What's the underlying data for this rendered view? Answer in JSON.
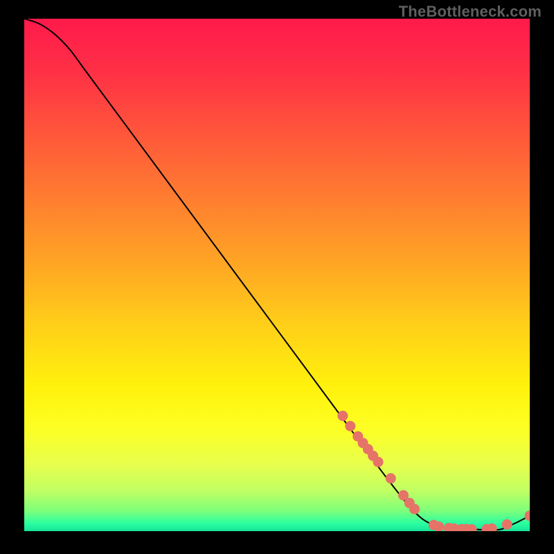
{
  "attribution": "TheBottleneck.com",
  "chart_data": {
    "type": "line",
    "title": "",
    "xlabel": "",
    "ylabel": "",
    "xlim": [
      0,
      100
    ],
    "ylim": [
      0,
      100
    ],
    "series": [
      {
        "name": "curve",
        "x": [
          0,
          3,
          6,
          9,
          12,
          18,
          30,
          45,
          60,
          72,
          78,
          82,
          86,
          90,
          94,
          97,
          100
        ],
        "y": [
          100,
          99,
          97,
          94,
          90,
          82,
          66,
          46,
          26,
          10,
          3,
          1,
          0.5,
          0.3,
          0.3,
          1.5,
          3
        ]
      }
    ],
    "markers": [
      {
        "name": "dots",
        "points": [
          {
            "x": 63,
            "y": 22.5
          },
          {
            "x": 64.5,
            "y": 20.5
          },
          {
            "x": 66,
            "y": 18.5
          },
          {
            "x": 67,
            "y": 17.2
          },
          {
            "x": 68,
            "y": 16
          },
          {
            "x": 69,
            "y": 14.7
          },
          {
            "x": 70,
            "y": 13.5
          },
          {
            "x": 72.5,
            "y": 10.3
          },
          {
            "x": 75,
            "y": 7
          },
          {
            "x": 76.2,
            "y": 5.5
          },
          {
            "x": 77.2,
            "y": 4.3
          },
          {
            "x": 81,
            "y": 1.2
          },
          {
            "x": 82,
            "y": 0.9
          },
          {
            "x": 84,
            "y": 0.6
          },
          {
            "x": 85,
            "y": 0.5
          },
          {
            "x": 86.5,
            "y": 0.4
          },
          {
            "x": 87.5,
            "y": 0.4
          },
          {
            "x": 88.5,
            "y": 0.35
          },
          {
            "x": 91.5,
            "y": 0.4
          },
          {
            "x": 92.5,
            "y": 0.5
          },
          {
            "x": 95.5,
            "y": 1.3
          },
          {
            "x": 100,
            "y": 3
          }
        ]
      }
    ],
    "gradient_stops": [
      {
        "offset": 0.0,
        "color": "#ff1a4b"
      },
      {
        "offset": 0.1,
        "color": "#ff2f46"
      },
      {
        "offset": 0.22,
        "color": "#ff553b"
      },
      {
        "offset": 0.35,
        "color": "#ff7d30"
      },
      {
        "offset": 0.48,
        "color": "#ffa624"
      },
      {
        "offset": 0.6,
        "color": "#ffd018"
      },
      {
        "offset": 0.72,
        "color": "#fff20c"
      },
      {
        "offset": 0.8,
        "color": "#fdff24"
      },
      {
        "offset": 0.87,
        "color": "#e7ff4d"
      },
      {
        "offset": 0.92,
        "color": "#c2ff62"
      },
      {
        "offset": 0.96,
        "color": "#7eff7a"
      },
      {
        "offset": 0.985,
        "color": "#2bffa0"
      },
      {
        "offset": 1.0,
        "color": "#15e39a"
      }
    ],
    "colors": {
      "curve": "#000000",
      "marker_fill": "#e57367",
      "marker_stroke": "#c95a4f"
    }
  }
}
